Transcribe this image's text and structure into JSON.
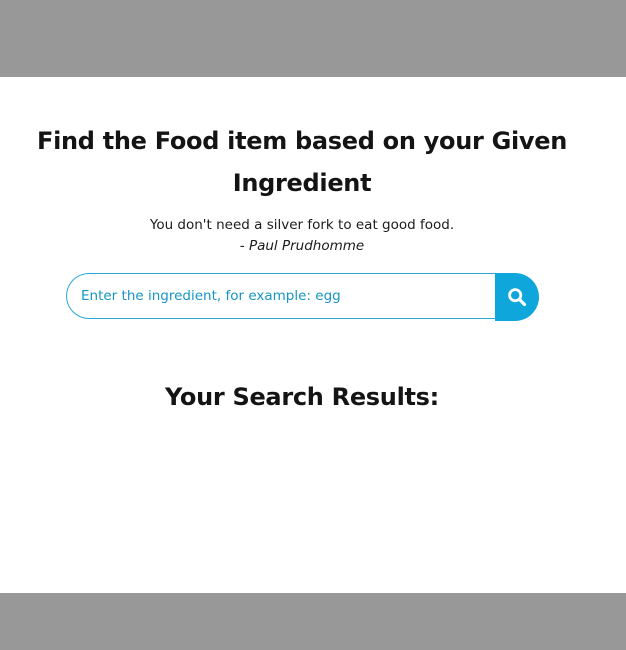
{
  "header": {
    "title_line1": "Find the Food item based on your Given",
    "title_line2": "Ingredient"
  },
  "quote": {
    "text": "You don't need a silver fork to eat good food.",
    "author": "- Paul Prudhomme"
  },
  "search": {
    "placeholder": "Enter the ingredient, for example: egg",
    "value": "",
    "button_icon": "search-icon",
    "accent_color": "#0fa6dc"
  },
  "results": {
    "heading": "Your Search Results:",
    "items": []
  },
  "colors": {
    "band": "#989898",
    "background": "#ffffff",
    "text": "#141414",
    "accent": "#0fa6dc"
  }
}
